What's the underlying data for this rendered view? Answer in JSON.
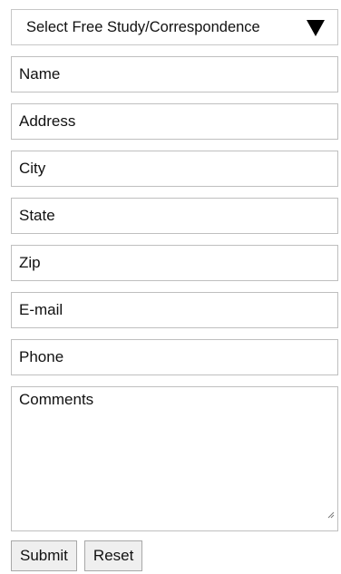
{
  "form": {
    "study_select": {
      "selected_value": "Select Free Study/Correspondence"
    },
    "fields": {
      "name_placeholder": "Name",
      "address_placeholder": "Address",
      "city_placeholder": "City",
      "state_placeholder": "State",
      "zip_placeholder": "Zip",
      "email_placeholder": "E-mail",
      "phone_placeholder": "Phone",
      "comments_placeholder": "Comments"
    },
    "buttons": {
      "submit_label": "Submit",
      "reset_label": "Reset"
    }
  },
  "icons": {
    "select_arrow": "triangle-down-icon",
    "textarea_resize": "resize-grip-icon"
  },
  "colors": {
    "border": "#bfbfbf",
    "button_background": "#efefef",
    "text": "#111111"
  }
}
